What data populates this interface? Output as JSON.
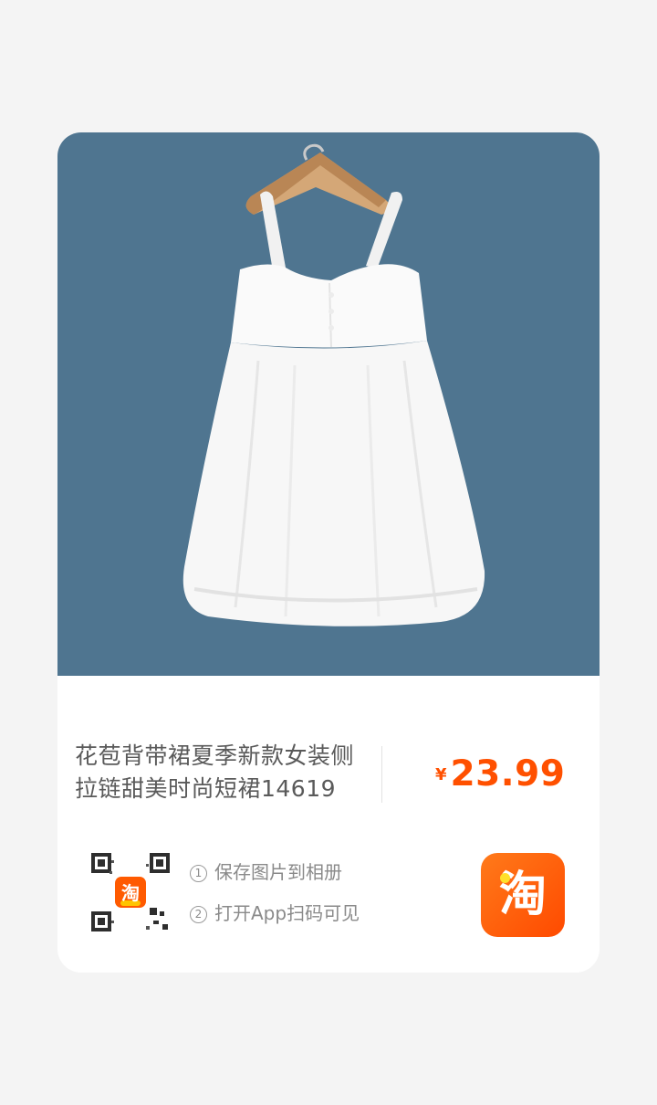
{
  "product": {
    "image_alt": "white sleeveless bubble-hem dress on a wooden hanger",
    "background_color": "#4f7590",
    "title": "花苞背带裙夏季新款女装侧拉链甜美时尚短裙14619",
    "currency": "¥",
    "price": "23.99",
    "price_color": "#ff5000"
  },
  "share": {
    "qr_code_icon": "qr-code",
    "qr_badge_text": "淘",
    "step1_number": "1",
    "step1_label": "保存图片到相册",
    "step2_number": "2",
    "step2_label": "打开App扫码可见",
    "app_icon_text": "淘",
    "app_icon_color": "#ff5000"
  }
}
